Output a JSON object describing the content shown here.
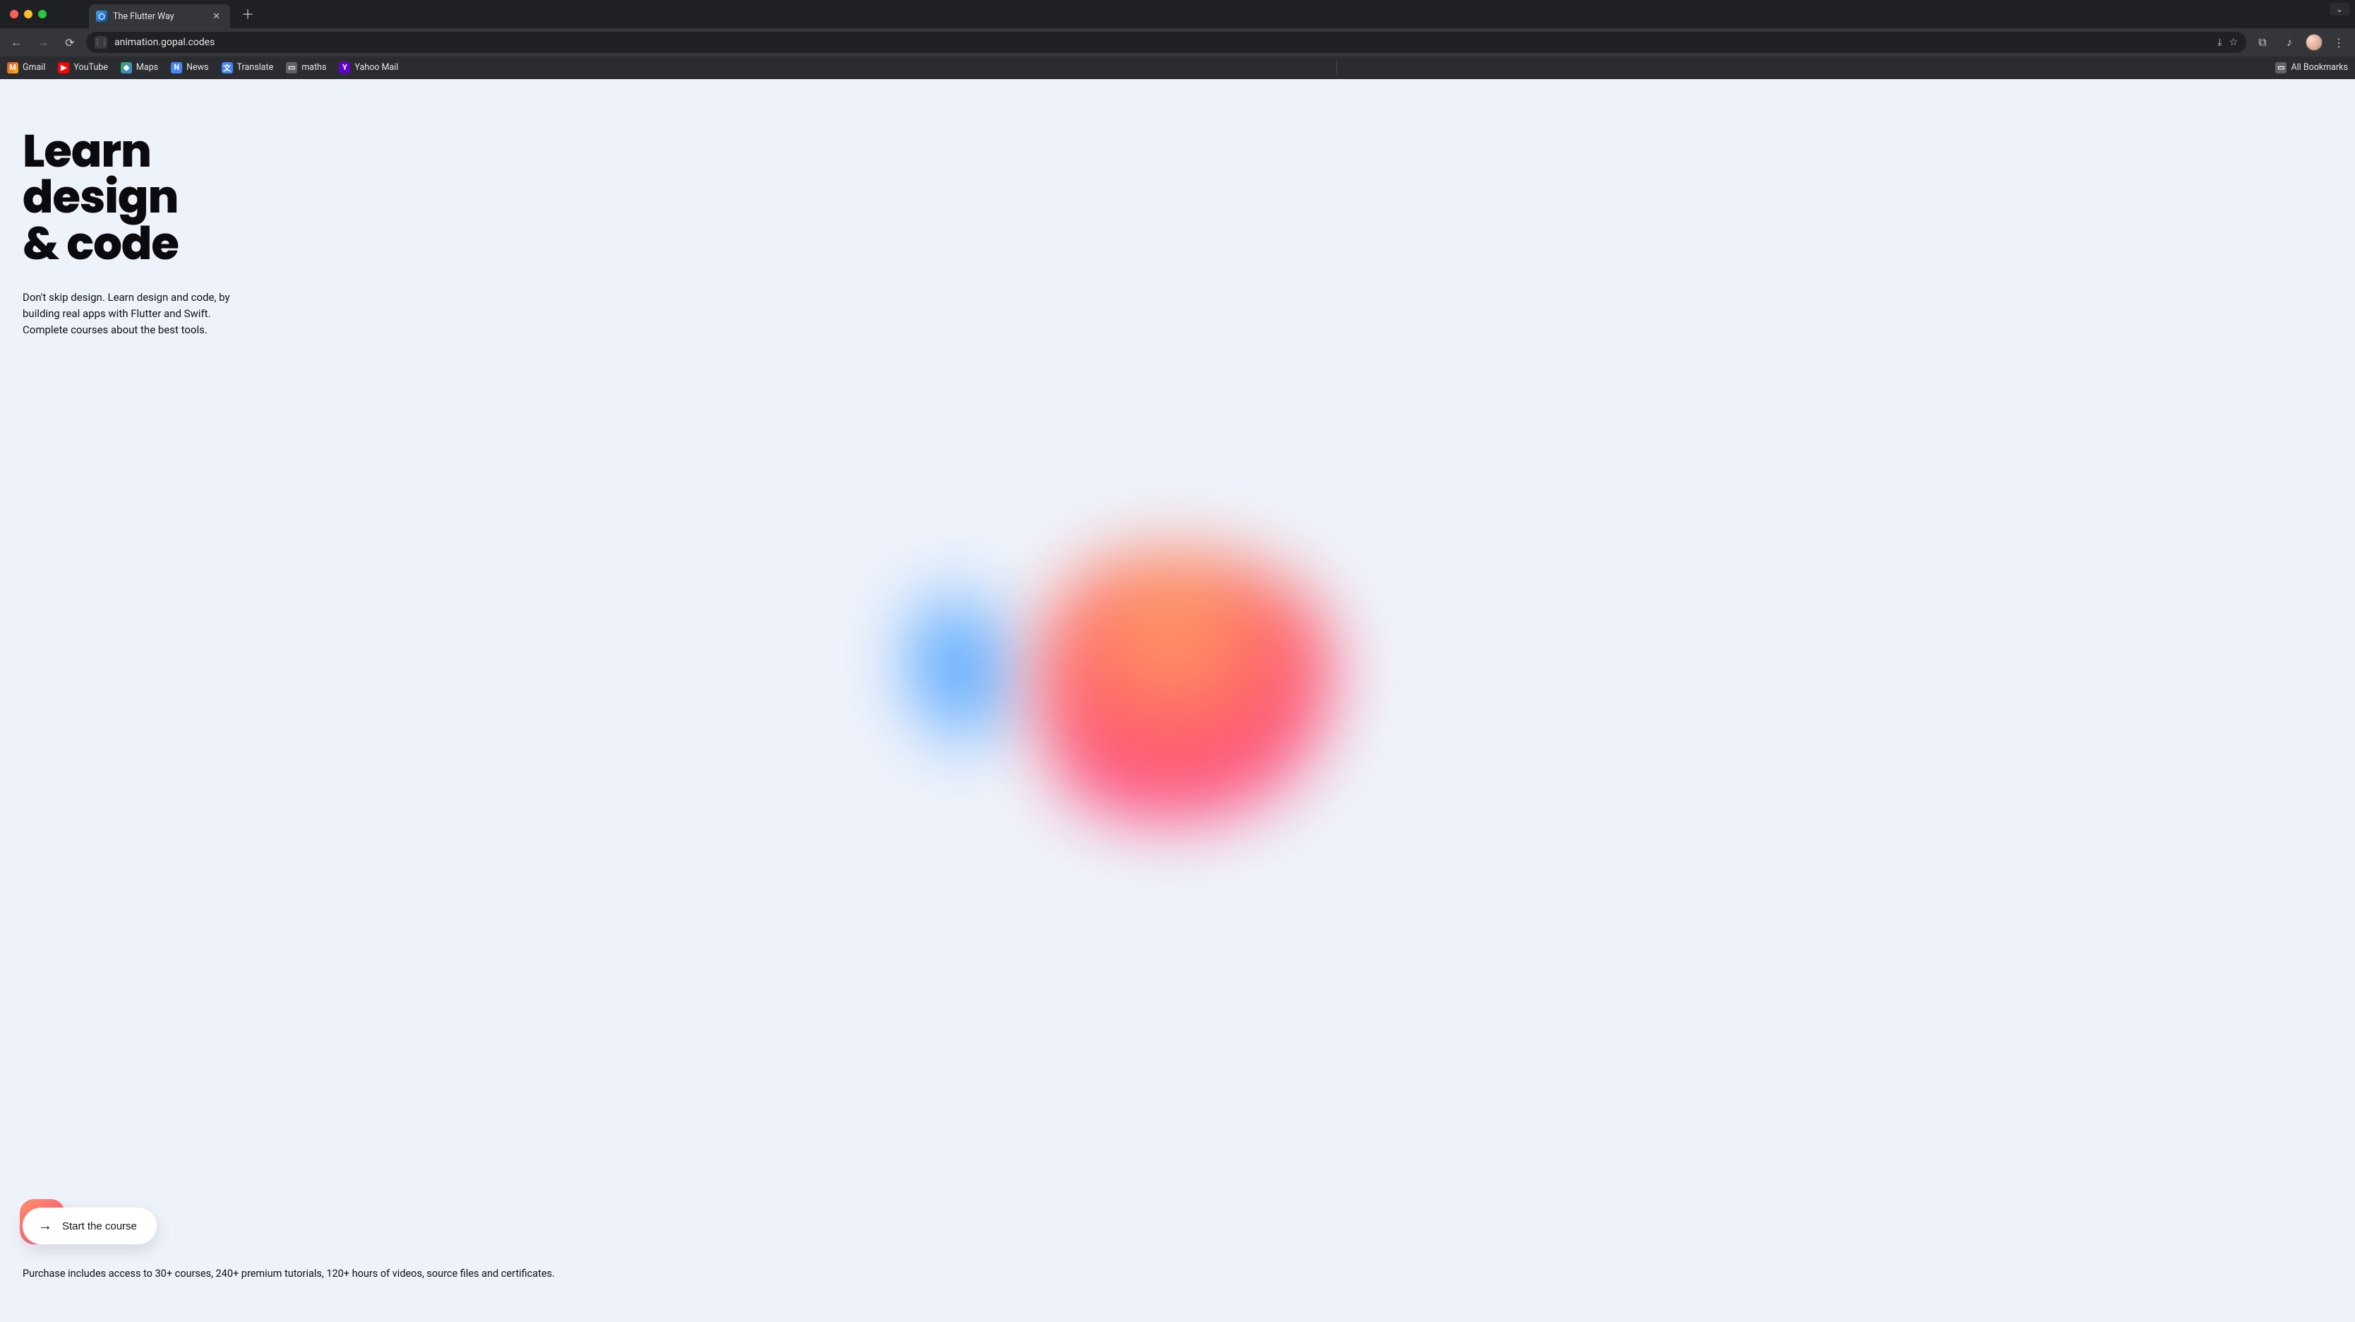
{
  "browser": {
    "tab": {
      "title": "The Flutter Way"
    },
    "url": "animation.gopal.codes",
    "bookmarks": [
      {
        "label": "Gmail",
        "cls": "gmail",
        "glyph": "M"
      },
      {
        "label": "YouTube",
        "cls": "youtube",
        "glyph": "▶"
      },
      {
        "label": "Maps",
        "cls": "maps",
        "glyph": "◆"
      },
      {
        "label": "News",
        "cls": "news",
        "glyph": "N"
      },
      {
        "label": "Translate",
        "cls": "translate",
        "glyph": "文"
      },
      {
        "label": "maths",
        "cls": "folder",
        "glyph": "▭"
      },
      {
        "label": "Yahoo Mail",
        "cls": "yahoo",
        "glyph": "Y"
      }
    ],
    "all_bookmarks_label": "All Bookmarks"
  },
  "page": {
    "headline": "Learn\ndesign\n& code",
    "subcopy": "Don't skip design. Learn design and code, by building real apps with Flutter and Swift. Complete courses about the best tools.",
    "cta_label": "Start the course",
    "footnote": "Purchase includes access to 30+ courses, 240+ premium tutorials, 120+ hours of videos, source files and certificates."
  }
}
